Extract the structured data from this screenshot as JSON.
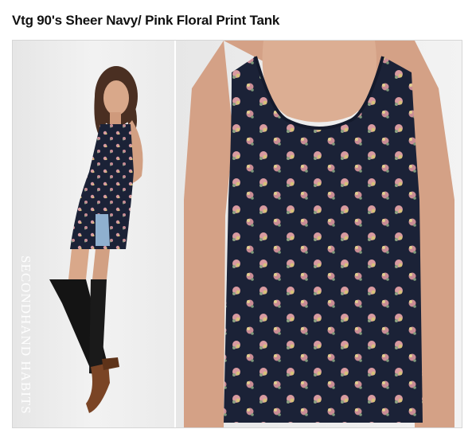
{
  "listing": {
    "title": "Vtg 90's Sheer Navy/ Pink Floral Print Tank"
  },
  "photos": {
    "watermark": "SECONDHAND HABITS"
  },
  "colors": {
    "dress": "#1b2237",
    "floral_pink": "#d89aa0",
    "floral_yellow": "#d6c27a",
    "floral_green": "#8aa080",
    "background": "#f1f1f1",
    "skin": "#d9a88a"
  }
}
